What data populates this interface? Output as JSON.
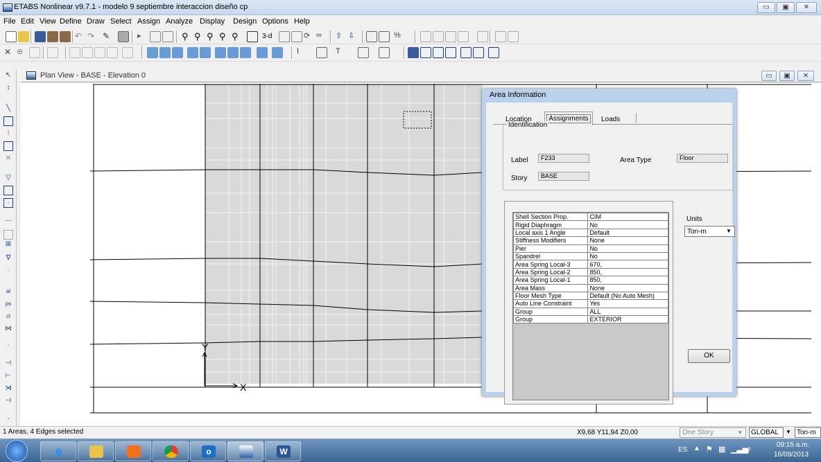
{
  "window": {
    "title": "ETABS Nonlinear v9.7.1 - modelo 9  septiembre interaccion diseño cp",
    "btn_minimize": "▭",
    "btn_restore": "▣",
    "btn_close": "✕"
  },
  "menu": [
    "File",
    "Edit",
    "View",
    "Define",
    "Draw",
    "Select",
    "Assign",
    "Analyze",
    "Display",
    "Design",
    "Options",
    "Help"
  ],
  "toolbar1_text": {
    "threed": "3-d"
  },
  "mdi": {
    "title": "Plan View - BASE - Elevation 0",
    "btn_min": "▭",
    "btn_restore": "▣",
    "btn_close": "✕"
  },
  "plan_labels": {
    "axis_y": "Y",
    "axis_x": "X"
  },
  "dialog": {
    "title": "Area Information",
    "tabs": [
      "Location",
      "Assignments",
      "Loads"
    ],
    "active_tab": "Assignments",
    "identification": {
      "group_title": "Identification",
      "label_caption": "Label",
      "label_value": "F233",
      "story_caption": "Story",
      "story_value": "BASE",
      "type_caption": "Area Type",
      "type_value": "Floor"
    },
    "properties": [
      [
        "Shell Section Prop.",
        "CIM"
      ],
      [
        "Rigid Diaphragm",
        "No"
      ],
      [
        "Local axis 1 Angle",
        "Default"
      ],
      [
        "Stiffness Modifiers",
        "None"
      ],
      [
        "Pier",
        "No"
      ],
      [
        "Spandrel",
        "No"
      ],
      [
        "Area Spring Local-3",
        "670,"
      ],
      [
        "Area Spring Local-2",
        "850,"
      ],
      [
        "Area Spring Local-1",
        "850,"
      ],
      [
        "Area Mass",
        "None"
      ],
      [
        "Floor Mesh Type",
        "Default (No Auto Mesh)"
      ],
      [
        "Auto Line Constraint",
        "Yes"
      ],
      [
        "Group",
        "ALL"
      ],
      [
        "Group",
        "EXTERIOR"
      ]
    ],
    "units_caption": "Units",
    "units_value": "Ton-m",
    "ok_label": "OK"
  },
  "status": {
    "selection": "1 Areas, 4 Edges selected",
    "coords": "X9,68  Y11,94  Z0,00",
    "story_mode": "One Story",
    "coord_system": "GLOBAL",
    "units": "Ton-m"
  },
  "taskbar": {
    "lang": "ES",
    "time": "09:15 a.m.",
    "date": "16/09/2013"
  }
}
